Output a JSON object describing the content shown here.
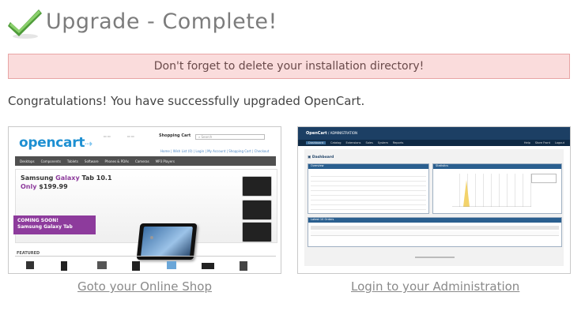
{
  "header": {
    "title": "Upgrade - Complete!"
  },
  "alert": {
    "text": "Don't forget to delete your installation directory!"
  },
  "message": {
    "text": "Congratulations! You have successfully upgraded OpenCart."
  },
  "shop": {
    "link_label": "Goto your Online Shop",
    "logo": "opencart",
    "cart_title": "Shopping Cart",
    "search_label": "Search",
    "menu": [
      "Desktops",
      "Components",
      "Tablets",
      "Software",
      "Phones & PDAs",
      "Cameras",
      "MP3 Players"
    ],
    "banner_title_1": "Samsung ",
    "banner_title_2": "Galaxy",
    "banner_title_3": " Tab 10.1",
    "banner_price_prefix": "Only ",
    "banner_price": "$199.99",
    "promo_line1": "COMING SOON!",
    "promo_line2": "Samsung Galaxy Tab",
    "featured": "FEATURED"
  },
  "admin": {
    "link_label": "Login to your Administration",
    "brand": "OpenCart",
    "brand_suffix": " / ADMINISTRATION",
    "dashboard": "Dashboard",
    "overview": "Overview",
    "statistics": "Statistics",
    "latest": "Latest 10 Orders",
    "menu": [
      "Dashboard",
      "Catalog",
      "Extensions",
      "Sales",
      "System",
      "Reports"
    ],
    "right_menu": [
      "Help",
      "Store Front",
      "Logout"
    ]
  },
  "colors": {
    "check": "#6ab64f",
    "alert_bg": "#fadcdc",
    "alert_border": "#e8a5a5"
  },
  "icons": {
    "header": "checkmark-icon"
  }
}
